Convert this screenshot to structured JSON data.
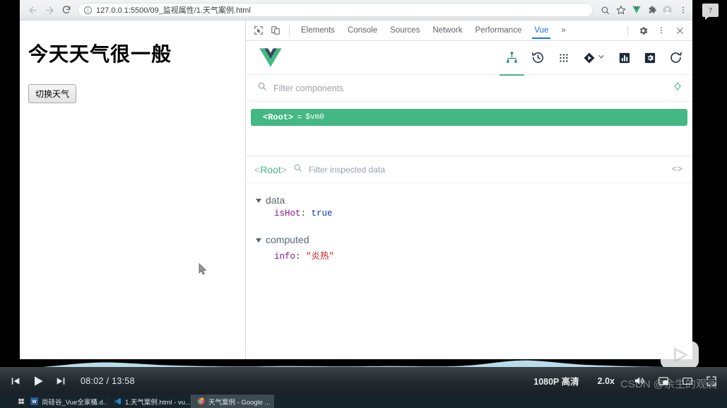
{
  "browser": {
    "back_icon": "back-arrow-icon",
    "forward_icon": "forward-arrow-icon",
    "reload_icon": "reload-icon",
    "url": "127.0.0.1:5500/09_监视属性/1.天气案例.html",
    "info_glyph": "ⓘ",
    "toolbar_icons": [
      "zoom-icon",
      "bookmark-star-icon",
      "vue-devtools-icon",
      "extensions-puzzle-icon",
      "profile-avatar-icon",
      "chrome-menu-icon"
    ]
  },
  "page": {
    "heading": "今天天气很一般",
    "button_label": "切换天气"
  },
  "devtools": {
    "inspect_icon": "inspect-element-icon",
    "device_icon": "device-toolbar-icon",
    "tabs": [
      {
        "label": "Elements",
        "active": false
      },
      {
        "label": "Console",
        "active": false
      },
      {
        "label": "Sources",
        "active": false
      },
      {
        "label": "Network",
        "active": false
      },
      {
        "label": "Performance",
        "active": false
      },
      {
        "label": "Vue",
        "active": true
      }
    ],
    "overflow_label": "»",
    "settings_icon": "gear-icon",
    "more_icon": "kebab-menu-icon",
    "close_icon": "close-icon"
  },
  "vue": {
    "logo": "vue-logo",
    "tools": [
      {
        "name": "components-tree-icon",
        "active": true
      },
      {
        "name": "timeline-history-icon",
        "active": false
      },
      {
        "name": "vuex-dots-icon",
        "active": false
      },
      {
        "name": "routing-diamond-icon",
        "active": false
      },
      {
        "name": "performance-bars-icon",
        "active": false
      },
      {
        "name": "settings-square-icon",
        "active": false
      },
      {
        "name": "refresh-icon",
        "active": false
      }
    ],
    "filter_placeholder": "Filter components",
    "filter_value": "",
    "target_icon": "select-target-icon",
    "tree": [
      {
        "tag": "<Root>",
        "eq": "=",
        "vm": "$vm0",
        "selected": true
      }
    ],
    "inspector": {
      "root_label": "<Root>",
      "root_open": "<",
      "root_name": "Root",
      "root_close": ">",
      "filter_placeholder": "Filter inspected data",
      "filter_value": "",
      "code_toggle": "<>",
      "groups": [
        {
          "name": "data",
          "expanded": true,
          "props": [
            {
              "key": "isHot",
              "value": "true",
              "type": "boolean"
            }
          ]
        },
        {
          "name": "computed",
          "expanded": true,
          "props": [
            {
              "key": "info",
              "value": "\"炎热\"",
              "type": "string"
            }
          ]
        }
      ]
    }
  },
  "player": {
    "prev_icon": "previous-track-icon",
    "play_icon": "play-icon",
    "next_icon": "next-track-icon",
    "current_time": "08:02",
    "separator": "/",
    "duration": "13:58",
    "time_display": "08:02 / 13:58",
    "quality_label": "1080P 高清",
    "speed_label": "2.0x",
    "volume_icon": "volume-icon",
    "pip_icon": "picture-in-picture-icon",
    "widescreen_icon": "widescreen-icon",
    "fullscreen_icon": "fullscreen-icon",
    "progress_percent": 56,
    "watermark": "CSDN @余生的观澜",
    "brand_logo": "bilibili-tv-logo"
  },
  "taskbar": {
    "start_icon": "windows-start-icon",
    "items": [
      {
        "label": "尚硅谷_Vue全家桶.d...",
        "icon": "word-icon",
        "color": "#2b5797",
        "active": false
      },
      {
        "label": "1.天气案例.html - vu...",
        "icon": "vscode-icon",
        "color": "#1e88c7",
        "active": false
      },
      {
        "label": "天气案例 - Google ...",
        "icon": "chrome-icon",
        "color": "#e8453c",
        "active": true
      }
    ]
  },
  "overlay": {
    "help_glyph": "?"
  }
}
